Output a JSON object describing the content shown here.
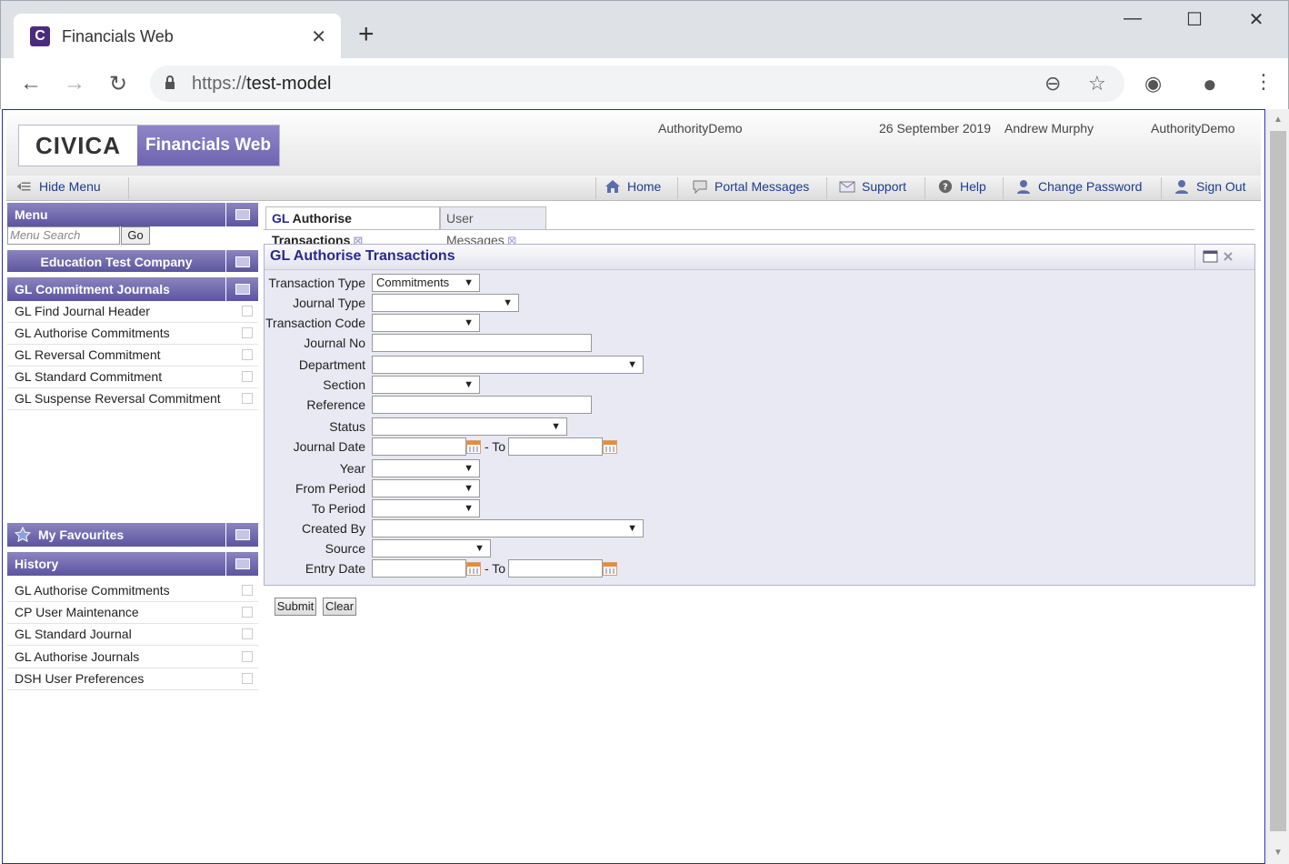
{
  "browser": {
    "tab_title": "Financials Web",
    "favicon_letter": "C",
    "url_scheme": "https://",
    "url_host": "test-model"
  },
  "header": {
    "logo_left": "CIVICA",
    "logo_right": "Financials Web",
    "authority": "AuthorityDemo",
    "date": "26 September 2019",
    "user": "Andrew Murphy",
    "authority_right": "AuthorityDemo"
  },
  "toolbar": {
    "hide_menu": "Hide Menu",
    "home": "Home",
    "portal_messages": "Portal Messages",
    "support": "Support",
    "help": "Help",
    "change_password": "Change Password",
    "sign_out": "Sign Out"
  },
  "sidebar": {
    "menu_title": "Menu",
    "search_placeholder": "Menu Search",
    "go_label": "Go",
    "company": "Education Test Company",
    "section_title": "GL Commitment Journals",
    "items": [
      {
        "label": "GL Find Journal Header"
      },
      {
        "label": "GL Authorise Commitments"
      },
      {
        "label": "GL Reversal Commitment"
      },
      {
        "label": "GL Standard Commitment"
      },
      {
        "label": "GL Suspense Reversal Commitment"
      }
    ],
    "favourites_title": "My Favourites",
    "history_title": "History",
    "history_items": [
      {
        "label": "GL Authorise Commitments"
      },
      {
        "label": "CP User Maintenance"
      },
      {
        "label": "GL Standard Journal"
      },
      {
        "label": "GL Authorise Journals"
      },
      {
        "label": "DSH User Preferences"
      }
    ]
  },
  "tabs": [
    {
      "prefix": "GL",
      "label": "Authorise Transactions"
    },
    {
      "label": "User Messages"
    }
  ],
  "form": {
    "title": "GL Authorise Transactions",
    "fields": {
      "transaction_type": {
        "label": "Transaction Type",
        "value": "Commitments"
      },
      "journal_type": {
        "label": "Journal Type",
        "value": ""
      },
      "transaction_code": {
        "label": "Transaction Code",
        "value": ""
      },
      "journal_no": {
        "label": "Journal No",
        "value": ""
      },
      "department": {
        "label": "Department",
        "value": ""
      },
      "section": {
        "label": "Section",
        "value": ""
      },
      "reference": {
        "label": "Reference",
        "value": ""
      },
      "status": {
        "label": "Status",
        "value": ""
      },
      "journal_date": {
        "label": "Journal Date",
        "to_label": "- To"
      },
      "year": {
        "label": "Year",
        "value": ""
      },
      "from_period": {
        "label": "From Period",
        "value": ""
      },
      "to_period": {
        "label": "To Period",
        "value": ""
      },
      "created_by": {
        "label": "Created By",
        "value": ""
      },
      "source": {
        "label": "Source",
        "value": ""
      },
      "entry_date": {
        "label": "Entry Date",
        "to_label": "- To"
      }
    },
    "submit_label": "Submit",
    "clear_label": "Clear"
  },
  "colors": {
    "brand_purple": "#6e64b0",
    "link_blue": "#1a3d8f",
    "panel_bg": "#e9e9f3"
  }
}
